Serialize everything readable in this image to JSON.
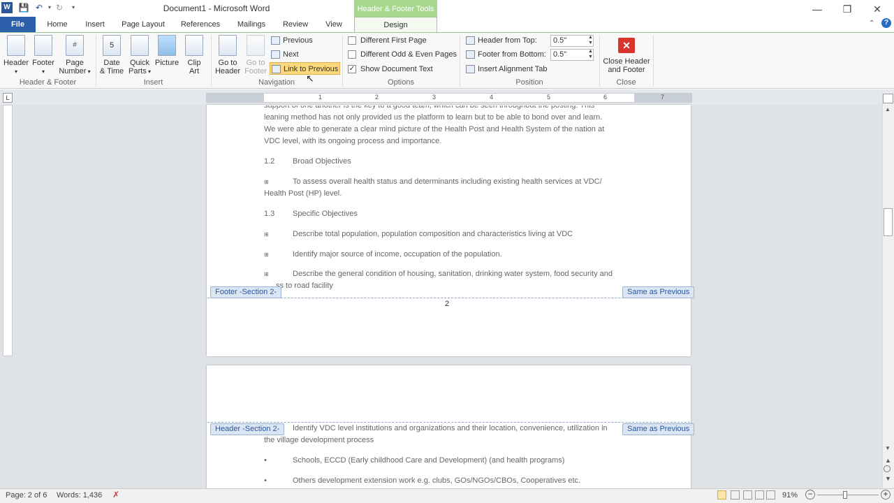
{
  "window": {
    "title": "Document1 - Microsoft Word",
    "context_tab": "Header & Footer Tools"
  },
  "tabs": [
    "File",
    "Home",
    "Insert",
    "Page Layout",
    "References",
    "Mailings",
    "Review",
    "View",
    "Design"
  ],
  "ribbon": {
    "hf_group": {
      "header": "Header",
      "footer": "Footer",
      "page": "Page",
      "number": "Number",
      "label": "Header & Footer"
    },
    "insert_group": {
      "date": "Date",
      "time": "& Time",
      "quick": "Quick",
      "parts": "Parts",
      "picture": "Picture",
      "clip": "Clip",
      "art": "Art",
      "label": "Insert"
    },
    "nav_group": {
      "goto_header_1": "Go to",
      "goto_header_2": "Header",
      "goto_footer_1": "Go to",
      "goto_footer_2": "Footer",
      "previous": "Previous",
      "next": "Next",
      "link_prev": "Link to Previous",
      "label": "Navigation"
    },
    "options_group": {
      "diff_first": "Different First Page",
      "diff_odd_even": "Different Odd & Even Pages",
      "show_doc_text": "Show Document Text",
      "label": "Options"
    },
    "position_group": {
      "header_from_top": "Header from Top:",
      "header_from_top_val": "0.5\"",
      "footer_from_bottom": "Footer from Bottom:",
      "footer_from_bottom_val": "0.5\"",
      "align_tab": "Insert Alignment Tab",
      "label": "Position"
    },
    "close_group": {
      "close1": "Close Header",
      "close2": "and Footer",
      "label": "Close"
    }
  },
  "ruler_numbers": [
    "1",
    "2",
    "3",
    "4",
    "5",
    "6",
    "7"
  ],
  "page1": {
    "line_partial": "support of one another is the key to a good team, which can be seen throughout the posting. This",
    "para1": [
      "leaning method has not only provided us the platform to learn but to be able to bond over and learn.",
      "We were able to generate a clear mind picture of the Health Post and Health System of the nation at",
      "VDC level, with its ongoing process and importance."
    ],
    "h12_num": "1.2",
    "h12": "Broad Objectives",
    "bullet_sym": "",
    "broad1_a": "To assess overall health status and determinants including existing health services at VDC/",
    "broad1_b": "Health Post (HP) level.",
    "h13_num": "1.3",
    "h13": "Specific Objectives",
    "spec1": "Describe total population, population composition and characteristics living at VDC",
    "spec2": "Identify major source of income, occupation of the population.",
    "spec3_a": "Describe the general condition of housing, sanitation, drinking water system, food security and",
    "spec3_b": "ss to road facility",
    "footer_label": "Footer -Section 2-",
    "same_prev": "Same as Previous",
    "page_num": "2"
  },
  "page2": {
    "header_label": "Header -Section 2-",
    "same_prev": "Same as Previous",
    "line1": "Identify VDC level institutions and organizations and their location, convenience, utilization in",
    "line1b": "the village development process",
    "bullet": "•",
    "b1": "Schools, ECCD (Early childhood Care and Development) (and health programs)",
    "b2": "Others development extension work e.g. clubs, GOs/NGOs/CBOs,  Cooperatives etc."
  },
  "status": {
    "page": "Page: 2 of 6",
    "words": "Words: 1,436",
    "zoom": "91%"
  }
}
